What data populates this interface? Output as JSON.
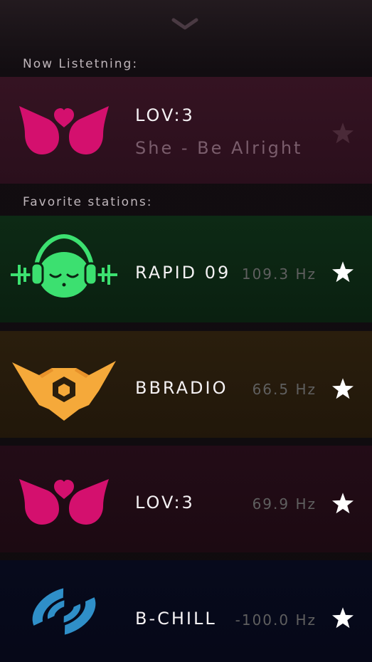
{
  "now_listening": {
    "label": "Now Listetning:",
    "station": "LOV:3",
    "song": "She - Be Alright",
    "logo": "heart-wings-logo",
    "color": "#d4106e"
  },
  "favorites": {
    "label": "Favorite stations:",
    "stations": [
      {
        "name": "RAPID 09",
        "frequency": "109.3 Hz",
        "logo": "headphones-face-logo",
        "color": "#3ce070"
      },
      {
        "name": "BBRADIO",
        "frequency": "66.5 Hz",
        "logo": "fox-hexagon-logo",
        "color": "#f5a93a"
      },
      {
        "name": "LOV:3",
        "frequency": "69.9 Hz",
        "logo": "heart-wings-logo",
        "color": "#d4106e"
      },
      {
        "name": "B-CHILL",
        "frequency": "-100.0 Hz",
        "logo": "signal-rings-logo",
        "color": "#2f8fc8"
      }
    ]
  },
  "icons": {
    "collapse": "chevron-down-icon",
    "favorite": "star-icon"
  }
}
